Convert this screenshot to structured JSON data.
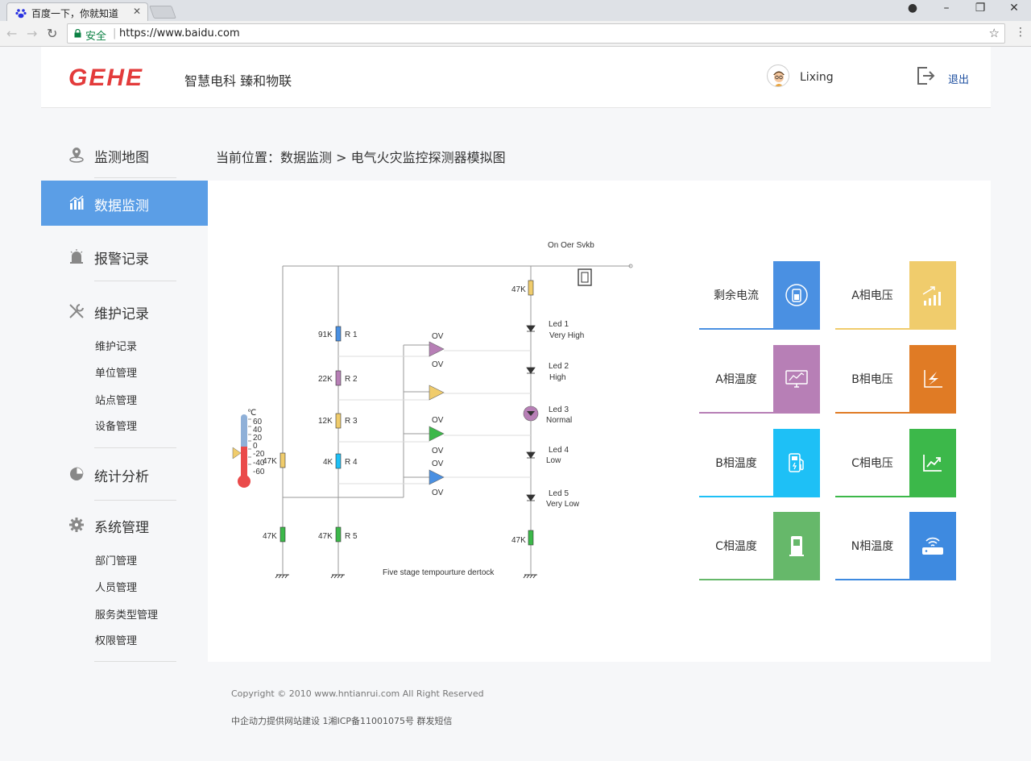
{
  "browser": {
    "tab_title": "百度一下，你就知道",
    "security_label": "安全",
    "url": "https://www.baidu.com"
  },
  "header": {
    "logo_text": "GEHE",
    "slogan": "智慧电科  臻和物联",
    "username": "Lixing",
    "logout_label": "退出"
  },
  "sidebar": {
    "items": [
      {
        "label": "监测地图",
        "icon": "map-pin-icon"
      },
      {
        "label": "数据监测",
        "icon": "bar-chart-icon"
      },
      {
        "label": "报警记录",
        "icon": "alarm-light-icon"
      },
      {
        "label": "维护记录",
        "icon": "wrench-icon"
      },
      {
        "label": "统计分析",
        "icon": "pie-chart-icon"
      },
      {
        "label": "系统管理",
        "icon": "gear-icon"
      }
    ],
    "maintenance_sub": [
      "维护记录",
      "单位管理",
      "站点管理",
      "设备管理"
    ],
    "system_sub": [
      "部门管理",
      "人员管理",
      "服务类型管理",
      "权限管理"
    ]
  },
  "breadcrumb": "当前位置：数据监测 > 电气火灾监控探测器模拟图",
  "circuit": {
    "top_caption": "On Oer Svkb",
    "bottom_caption": "Five stage tempourture dertock",
    "unit": "℃",
    "scale": [
      "60",
      "40",
      "20",
      "0",
      "-20",
      "-40",
      "-60"
    ],
    "resistors": [
      {
        "value": "91K",
        "name": "R 1"
      },
      {
        "value": "22K",
        "name": "R 2"
      },
      {
        "value": "12K",
        "name": "R 3"
      },
      {
        "value": "4K",
        "name": "R 4"
      },
      {
        "value": "47K",
        "name": "R 5"
      }
    ],
    "other_resistors": [
      "47K",
      "47K",
      "47K",
      "47K"
    ],
    "leds": [
      {
        "name": "Led 1",
        "level": "Very High"
      },
      {
        "name": "Led 2",
        "level": "High"
      },
      {
        "name": "Led 3",
        "level": "Normal"
      },
      {
        "name": "Led 4",
        "level": "Low"
      },
      {
        "name": "Led 5",
        "level": "Very Low"
      }
    ],
    "op_label": "OV"
  },
  "cards": [
    {
      "title": "剩余电流",
      "color": "#4a90e2",
      "icon": "battery-icon"
    },
    {
      "title": "A相电压",
      "color": "#f0cc6c",
      "icon": "bar-growth-icon"
    },
    {
      "title": "A相温度",
      "color": "#b77fb6",
      "icon": "monitor-chart-icon"
    },
    {
      "title": "B相电压",
      "color": "#e07b25",
      "icon": "lightning-chart-icon"
    },
    {
      "title": "B相温度",
      "color": "#1ec0f6",
      "icon": "fuel-pump-icon"
    },
    {
      "title": "C相电压",
      "color": "#3cb84a",
      "icon": "trend-up-icon"
    },
    {
      "title": "C相温度",
      "color": "#66b86a",
      "icon": "dispenser-icon"
    },
    {
      "title": "N相温度",
      "color": "#3e8ae0",
      "icon": "router-icon"
    }
  ],
  "footer": {
    "copyright": "Copyright © 2010 www.hntianrui.com All Right Reserved",
    "icp": "中企动力提供网站建设   1湘ICP备11001075号 群发短信"
  }
}
